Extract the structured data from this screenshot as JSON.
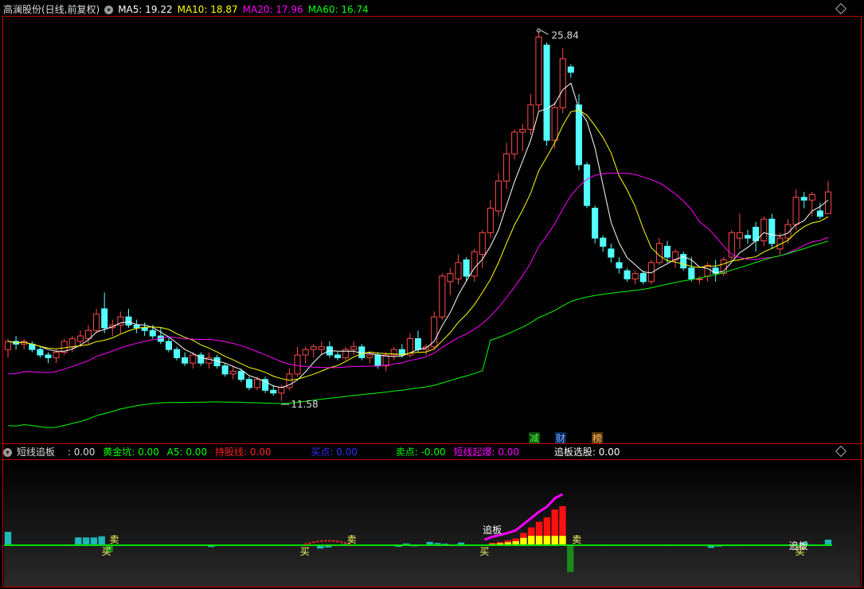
{
  "header": {
    "title": "高澜股份(日线,前复权)",
    "ma": [
      {
        "label": "MA5: 19.22",
        "color": "#ffffff"
      },
      {
        "label": "MA10: 18.87",
        "color": "#ffff00"
      },
      {
        "label": "MA20: 17.96",
        "color": "#ff00ff"
      },
      {
        "label": "MA60: 16.74",
        "color": "#00ff00"
      }
    ]
  },
  "sub_header": {
    "title": "短线追板",
    "items": [
      {
        "label": ": 0.00",
        "color": "#dddddd"
      },
      {
        "label": "黄金坑: 0.00",
        "color": "#00ff00"
      },
      {
        "label": "A5: 0.00",
        "color": "#00ff00"
      },
      {
        "label": "持股线: 0.00",
        "color": "#ff2020"
      },
      {
        "label": "买点: 0.00",
        "color": "#3030ff"
      },
      {
        "label": "卖点: -0.00",
        "color": "#00ff00"
      },
      {
        "label": "短线起爆: 0.00",
        "color": "#ff00ff"
      },
      {
        "label": "追板选股: 0.00",
        "color": "#ffffff"
      }
    ]
  },
  "markers": {
    "reduce": "减",
    "finance": "财",
    "rank": "榜"
  },
  "annotations": {
    "high": "25.84",
    "low": "11.58",
    "buy": "买",
    "sell": "卖",
    "chase": "追板"
  },
  "colors": {
    "up": "#ff4a4a",
    "down": "#54ffff",
    "ma5": "#ffffff",
    "ma10": "#ffff00",
    "ma20": "#ff00ff",
    "ma60": "#00ff00",
    "frame": "#c00000"
  },
  "chart_data": [
    {
      "type": "candlestick",
      "title": "高澜股份(日线,前复权)",
      "ylim": [
        11.0,
        26.2
      ],
      "high": 25.84,
      "low": 11.58,
      "ohlc": [
        [
          14.1,
          14.5,
          13.8,
          14.4
        ],
        [
          14.4,
          14.6,
          14.1,
          14.3
        ],
        [
          14.3,
          14.5,
          14.1,
          14.4
        ],
        [
          14.3,
          14.4,
          14.0,
          14.1
        ],
        [
          14.1,
          14.2,
          13.8,
          13.9
        ],
        [
          13.9,
          14.0,
          13.6,
          13.8
        ],
        [
          13.8,
          14.1,
          13.6,
          14.0
        ],
        [
          14.0,
          14.5,
          13.9,
          14.4
        ],
        [
          14.2,
          14.6,
          14.0,
          14.5
        ],
        [
          14.4,
          14.8,
          14.2,
          14.6
        ],
        [
          14.5,
          15.0,
          14.3,
          14.8
        ],
        [
          14.8,
          15.6,
          14.7,
          15.4
        ],
        [
          15.6,
          16.2,
          14.7,
          14.9
        ],
        [
          14.9,
          15.2,
          14.6,
          15.0
        ],
        [
          15.0,
          15.5,
          14.7,
          15.3
        ],
        [
          15.3,
          15.6,
          14.9,
          15.0
        ],
        [
          15.0,
          15.2,
          14.7,
          14.9
        ],
        [
          14.9,
          15.1,
          14.6,
          14.8
        ],
        [
          14.8,
          15.0,
          14.5,
          14.6
        ],
        [
          14.6,
          14.9,
          14.3,
          14.4
        ],
        [
          14.4,
          14.6,
          14.0,
          14.1
        ],
        [
          14.1,
          14.2,
          13.7,
          13.8
        ],
        [
          13.8,
          14.0,
          13.5,
          13.6
        ],
        [
          13.6,
          14.0,
          13.4,
          13.9
        ],
        [
          13.9,
          14.0,
          13.5,
          13.6
        ],
        [
          13.6,
          14.0,
          13.4,
          13.8
        ],
        [
          13.8,
          13.9,
          13.4,
          13.5
        ],
        [
          13.5,
          13.6,
          13.1,
          13.2
        ],
        [
          13.2,
          13.5,
          13.0,
          13.3
        ],
        [
          13.3,
          13.4,
          12.9,
          13.0
        ],
        [
          13.0,
          13.1,
          12.6,
          12.7
        ],
        [
          12.7,
          13.1,
          12.6,
          13.0
        ],
        [
          13.0,
          13.1,
          12.5,
          12.6
        ],
        [
          12.6,
          12.8,
          12.4,
          12.5
        ],
        [
          12.5,
          12.8,
          12.2,
          12.7
        ],
        [
          12.7,
          13.4,
          12.6,
          13.2
        ],
        [
          13.2,
          14.2,
          13.1,
          13.9
        ],
        [
          13.9,
          14.2,
          13.6,
          14.1
        ],
        [
          14.1,
          14.3,
          13.8,
          14.2
        ],
        [
          14.1,
          14.4,
          13.9,
          14.2
        ],
        [
          14.2,
          14.4,
          13.8,
          13.9
        ],
        [
          13.9,
          14.0,
          13.7,
          13.8
        ],
        [
          13.8,
          14.2,
          13.7,
          14.1
        ],
        [
          14.1,
          14.4,
          13.9,
          14.2
        ],
        [
          14.2,
          14.3,
          13.7,
          13.8
        ],
        [
          13.8,
          14.0,
          13.6,
          13.9
        ],
        [
          13.9,
          14.0,
          13.4,
          13.5
        ],
        [
          13.5,
          14.0,
          13.3,
          13.9
        ],
        [
          13.9,
          14.2,
          13.7,
          14.1
        ],
        [
          14.1,
          14.3,
          13.8,
          13.9
        ],
        [
          13.9,
          14.7,
          13.8,
          14.5
        ],
        [
          14.5,
          14.8,
          14.0,
          14.1
        ],
        [
          14.1,
          14.3,
          13.9,
          14.2
        ],
        [
          14.2,
          15.5,
          14.1,
          15.3
        ],
        [
          15.3,
          16.9,
          15.2,
          16.8
        ],
        [
          16.6,
          17.1,
          16.1,
          16.9
        ],
        [
          16.7,
          17.6,
          16.5,
          17.3
        ],
        [
          17.4,
          17.5,
          16.6,
          16.8
        ],
        [
          16.8,
          17.8,
          16.6,
          17.7
        ],
        [
          17.6,
          18.5,
          17.1,
          18.4
        ],
        [
          18.4,
          19.6,
          18.2,
          19.3
        ],
        [
          19.2,
          20.6,
          19.0,
          20.3
        ],
        [
          20.3,
          21.7,
          20.0,
          21.3
        ],
        [
          21.3,
          22.2,
          21.1,
          22.1
        ],
        [
          22.1,
          22.4,
          21.4,
          22.2
        ],
        [
          22.2,
          23.5,
          22.0,
          23.1
        ],
        [
          23.1,
          25.84,
          22.9,
          25.6
        ],
        [
          25.3,
          25.4,
          21.6,
          21.8
        ],
        [
          21.8,
          23.2,
          21.5,
          23.0
        ],
        [
          23.0,
          25.2,
          22.8,
          24.8
        ],
        [
          24.5,
          24.6,
          24.1,
          24.3
        ],
        [
          23.1,
          23.5,
          20.7,
          20.9
        ],
        [
          20.9,
          21.0,
          19.3,
          19.4
        ],
        [
          19.3,
          19.4,
          18.0,
          18.2
        ],
        [
          18.2,
          18.3,
          17.7,
          17.9
        ],
        [
          17.8,
          18.0,
          17.3,
          17.5
        ],
        [
          17.3,
          17.5,
          16.9,
          17.1
        ],
        [
          17.0,
          17.1,
          16.6,
          16.7
        ],
        [
          16.7,
          17.0,
          16.5,
          16.9
        ],
        [
          16.9,
          17.0,
          16.5,
          16.6
        ],
        [
          16.6,
          17.4,
          16.5,
          17.3
        ],
        [
          17.3,
          18.2,
          17.2,
          18.0
        ],
        [
          17.9,
          18.1,
          17.3,
          17.5
        ],
        [
          17.4,
          17.8,
          17.1,
          17.7
        ],
        [
          17.6,
          17.7,
          17.0,
          17.1
        ],
        [
          17.1,
          17.5,
          16.6,
          16.7
        ],
        [
          16.7,
          16.8,
          16.5,
          16.7
        ],
        [
          16.8,
          17.3,
          16.6,
          17.2
        ],
        [
          17.1,
          17.4,
          16.6,
          16.9
        ],
        [
          16.9,
          17.5,
          16.8,
          17.4
        ],
        [
          17.5,
          18.5,
          17.4,
          18.4
        ],
        [
          18.2,
          19.1,
          17.8,
          18.4
        ],
        [
          18.3,
          18.5,
          18.0,
          18.2
        ],
        [
          18.6,
          18.8,
          17.7,
          18.1
        ],
        [
          18.1,
          19.0,
          17.9,
          18.9
        ],
        [
          18.9,
          19.1,
          17.8,
          18.0
        ],
        [
          17.8,
          18.4,
          17.6,
          18.2
        ],
        [
          18.2,
          18.9,
          18.0,
          18.7
        ],
        [
          18.7,
          20.0,
          18.5,
          19.7
        ],
        [
          19.7,
          19.9,
          19.3,
          19.6
        ],
        [
          19.6,
          19.9,
          19.0,
          19.8
        ],
        [
          19.2,
          19.5,
          18.9,
          19.0
        ],
        [
          19.1,
          20.3,
          19.1,
          19.9
        ]
      ]
    },
    {
      "type": "bar",
      "title": "短线追板",
      "values": [
        0.6,
        0,
        0,
        0,
        0,
        0,
        0,
        0,
        0,
        0.35,
        0.35,
        0.35,
        0.4,
        -0.3,
        0,
        0,
        0,
        0,
        0,
        0,
        0,
        0,
        0,
        0,
        0,
        0,
        -0.08,
        0,
        0,
        0,
        0,
        0,
        0,
        0,
        0,
        0,
        0,
        0,
        0,
        0,
        -0.15,
        -0.1,
        0,
        0.05,
        0,
        0,
        0,
        0,
        0,
        0,
        -0.07,
        0.08,
        -0.05,
        0,
        0.15,
        0.1,
        0.07,
        0,
        0.12,
        0,
        0,
        0,
        0.1,
        0.15,
        0.22,
        0.3,
        0.55,
        0.8,
        1.05,
        1.25,
        1.6,
        1.75,
        -1.2,
        0,
        0,
        0,
        0,
        0,
        0,
        0,
        0,
        0,
        0,
        0,
        0,
        0,
        0,
        0,
        0,
        0,
        -0.12,
        -0.06,
        0,
        -0.04,
        0,
        0,
        0,
        0,
        0,
        0,
        0,
        0,
        0.12,
        0,
        0,
        0.25
      ]
    }
  ]
}
